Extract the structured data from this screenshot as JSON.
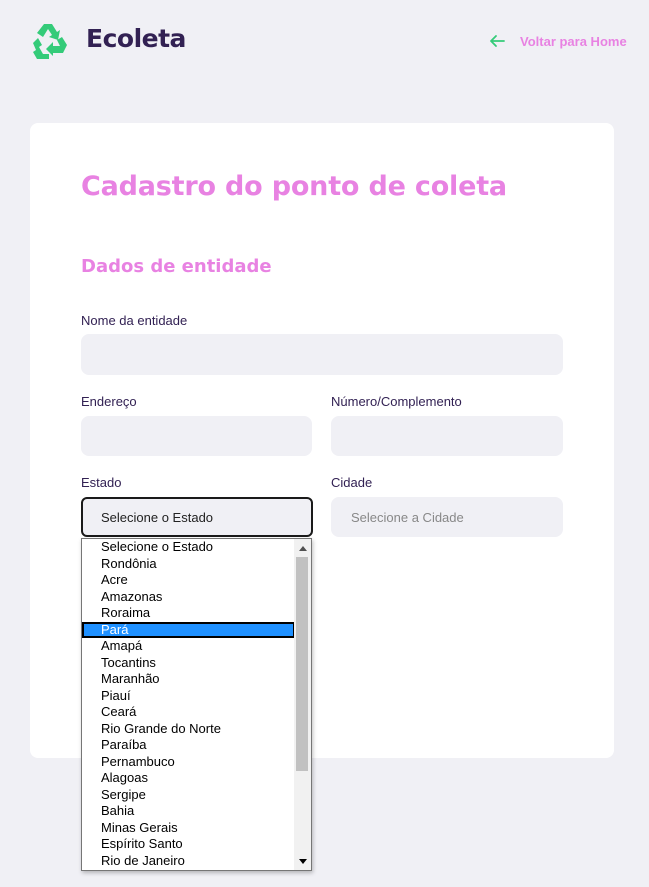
{
  "header": {
    "brand": "Ecoleta",
    "back_link_label": "Voltar para Home"
  },
  "form": {
    "title": "Cadastro do ponto de coleta",
    "section_title": "Dados de entidade",
    "name_label": "Nome da entidade",
    "name_value": "",
    "address_label": "Endereço",
    "address_value": "",
    "number_label": "Número/Complemento",
    "number_value": "",
    "state_label": "Estado",
    "state_selected": "Selecione o Estado",
    "city_label": "Cidade",
    "city_selected": "Selecione a Cidade"
  },
  "state_dropdown": {
    "highlighted": "Pará",
    "options": [
      "Selecione o Estado",
      "Rondônia",
      "Acre",
      "Amazonas",
      "Roraima",
      "Pará",
      "Amapá",
      "Tocantins",
      "Maranhão",
      "Piauí",
      "Ceará",
      "Rio Grande do Norte",
      "Paraíba",
      "Pernambuco",
      "Alagoas",
      "Sergipe",
      "Bahia",
      "Minas Gerais",
      "Espírito Santo",
      "Rio de Janeiro"
    ]
  },
  "colors": {
    "accent_pink": "#e882e2",
    "brand_dark": "#322153",
    "green": "#34cb79",
    "selection_blue": "#1e90ff"
  }
}
